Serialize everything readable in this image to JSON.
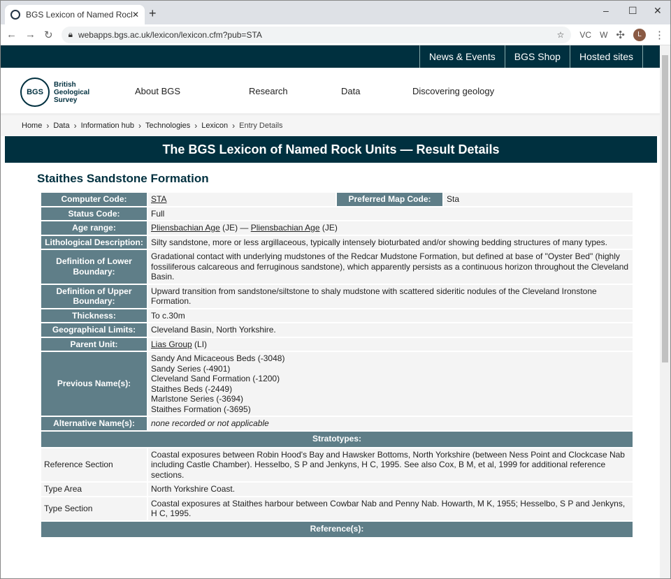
{
  "browser": {
    "tab_title": "BGS Lexicon of Named Rock Unit",
    "url": "webapps.bgs.ac.uk/lexicon/lexicon.cfm?pub=STA",
    "profile_initial": "L",
    "ext1": "VC",
    "ext2": "W"
  },
  "topnav": [
    "News & Events",
    "BGS Shop",
    "Hosted sites"
  ],
  "logo": {
    "mark": "BGS",
    "line1": "British",
    "line2": "Geological",
    "line3": "Survey"
  },
  "mainnav": [
    "About BGS",
    "Research",
    "Data",
    "Discovering geology"
  ],
  "breadcrumb": [
    "Home",
    "Data",
    "Information hub",
    "Technologies",
    "Lexicon",
    "Entry Details"
  ],
  "banner": "The BGS Lexicon of Named Rock Units — Result Details",
  "unit_name": "Staithes Sandstone Formation",
  "fields": {
    "computer_code_label": "Computer Code:",
    "computer_code": "STA",
    "map_code_label": "Preferred Map Code:",
    "map_code": "Sta",
    "status_label": "Status Code:",
    "status": "Full",
    "age_label": "Age range:",
    "age_from": "Pliensbachian Age",
    "age_from_code": " (JE) — ",
    "age_to": "Pliensbachian Age",
    "age_to_code": " (JE)",
    "litho_label": "Lithological Description:",
    "litho": "Silty sandstone, more or less argillaceous, typically intensely bioturbated and/or showing bedding structures of many types.",
    "lower_label": "Definition of Lower Boundary:",
    "lower": "Gradational contact with underlying mudstones of the Redcar Mudstone Formation, but defined at base of \"Oyster Bed\" (highly fossiliferous calcareous and ferruginous sandstone), which apparently persists as a continuous horizon throughout the Cleveland Basin.",
    "upper_label": "Definition of Upper Boundary:",
    "upper": "Upward transition from sandstone/siltstone to shaly mudstone with scattered sideritic nodules of the Cleveland Ironstone Formation.",
    "thickness_label": "Thickness:",
    "thickness": "To c.30m",
    "geo_label": "Geographical Limits:",
    "geo": "Cleveland Basin, North Yorkshire.",
    "parent_label": "Parent Unit:",
    "parent": "Lias Group",
    "parent_code": " (LI)",
    "previous_label": "Previous Name(s):",
    "previous": [
      "Sandy And Micaceous Beds (-3048)",
      "Sandy Series (-4901)",
      "Cleveland Sand Formation (-1200)",
      "Staithes Beds (-2449)",
      "Marlstone Series (-3694)",
      "Staithes Formation (-3695)"
    ],
    "alt_label": "Alternative Name(s):",
    "alt": "none recorded or not applicable"
  },
  "stratotypes": {
    "heading": "Stratotypes:",
    "rows": [
      {
        "type": "Reference Section",
        "text": "Coastal exposures between Robin Hood's Bay and Hawsker Bottoms, North Yorkshire (between Ness Point and Clockcase Nab including Castle Chamber). Hesselbo, S P and Jenkyns, H C, 1995. See also Cox, B M, et al, 1999 for additional reference sections."
      },
      {
        "type": "Type Area",
        "text": "North Yorkshire Coast."
      },
      {
        "type": "Type Section",
        "text": "Coastal exposures at Staithes harbour between Cowbar Nab and Penny Nab. Howarth, M K, 1955; Hesselbo, S P and Jenkyns, H C, 1995."
      }
    ]
  },
  "references_heading": "Reference(s):"
}
